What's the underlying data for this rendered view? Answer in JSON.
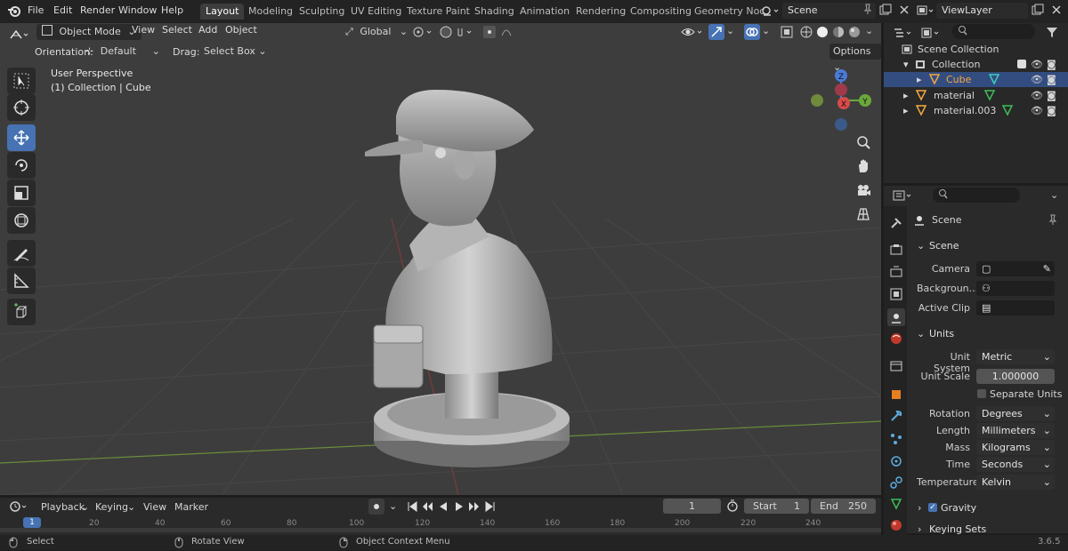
{
  "menubar": {
    "items": [
      "File",
      "Edit",
      "Render",
      "Window",
      "Help"
    ],
    "workspaces": [
      "Layout",
      "Modeling",
      "Sculpting",
      "UV Editing",
      "Texture Paint",
      "Shading",
      "Animation",
      "Rendering",
      "Compositing",
      "Geometry Noc"
    ],
    "scene_name": "Scene",
    "view_layer": "ViewLayer"
  },
  "viewport_header": {
    "mode": "Object Mode",
    "menus": [
      "View",
      "Select",
      "Add",
      "Object"
    ],
    "transform_orientation": "Global",
    "orientation_label": "Orientation:",
    "orientation_value": "Default",
    "drag_label": "Drag:",
    "drag_value": "Select Box",
    "options_label": "Options"
  },
  "viewport": {
    "perspective_label": "User Perspective",
    "collection_label": "(1) Collection | Cube",
    "gizmo": {
      "z": "Z",
      "y": "Y",
      "x": "X"
    }
  },
  "outliner": {
    "search_placeholder": "",
    "root": "Scene Collection",
    "rows": [
      {
        "label": "Collection"
      },
      {
        "label": "Cube"
      },
      {
        "label": "material"
      },
      {
        "label": "material.003"
      }
    ]
  },
  "properties": {
    "header": "Scene",
    "scene_section": "Scene",
    "camera_label": "Camera",
    "background_label": "Backgroun...",
    "active_clip_label": "Active Clip",
    "units_section": "Units",
    "unit_system_label": "Unit System",
    "unit_system_value": "Metric",
    "unit_scale_label": "Unit Scale",
    "unit_scale_value": "1.000000",
    "separate_units_label": "Separate Units",
    "rotation_label": "Rotation",
    "rotation_value": "Degrees",
    "length_label": "Length",
    "length_value": "Millimeters",
    "mass_label": "Mass",
    "mass_value": "Kilograms",
    "time_label": "Time",
    "time_value": "Seconds",
    "temperature_label": "Temperature",
    "temperature_value": "Kelvin",
    "gravity_label": "Gravity",
    "keying_sets_label": "Keying Sets"
  },
  "timeline": {
    "menus": [
      "Playback",
      "Keying",
      "View",
      "Marker"
    ],
    "current_frame": "1",
    "start_label": "Start",
    "start_value": "1",
    "end_label": "End",
    "end_value": "250",
    "ticks": [
      "1",
      "20",
      "40",
      "60",
      "80",
      "100",
      "120",
      "140",
      "160",
      "180",
      "200",
      "220",
      "240"
    ]
  },
  "statusbar": {
    "select": "Select",
    "rotate_view": "Rotate View",
    "context_menu": "Object Context Menu",
    "version": "3.6.5"
  },
  "colors": {
    "accent": "#4772b3",
    "viewport_bg": "#3d3d3d",
    "header_bg": "#232323",
    "panel_bg": "#2a2a2a",
    "selection": "#334d80",
    "cube_label": "#f5a741"
  }
}
